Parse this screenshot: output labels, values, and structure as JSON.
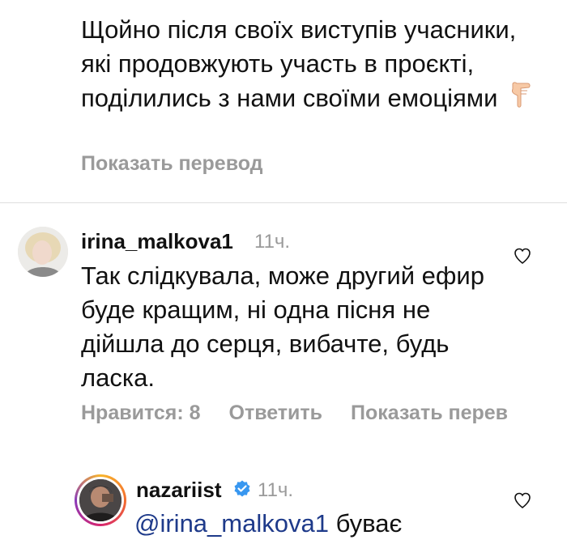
{
  "post": {
    "caption": "Щойно після своїх виступів учасники, які продовжують участь в проєкті, поділились з нами своїми емоціями",
    "translate_label": "Показать перевод"
  },
  "comments": [
    {
      "username": "irina_malkova1",
      "time": "11ч.",
      "text": "Так слідкувала, може другий ефир буде кращим, ні одна пісня не дійшла до серця, вибачте, будь ласка.",
      "likes_label": "Нравится: 8",
      "reply_label": "Ответить",
      "translate_label": "Показать перев"
    },
    {
      "username": "nazariist",
      "verified": true,
      "time": "11ч.",
      "mention": "@irina_malkova1",
      "text": "буває"
    }
  ],
  "icons": {
    "heart": "heart-outline-icon",
    "verified": "verified-badge-icon",
    "emoji": "backhand-index-pointing-down"
  },
  "colors": {
    "muted": "#9a9a9a",
    "mention": "#1e3a8a",
    "verified": "#3897f0"
  }
}
